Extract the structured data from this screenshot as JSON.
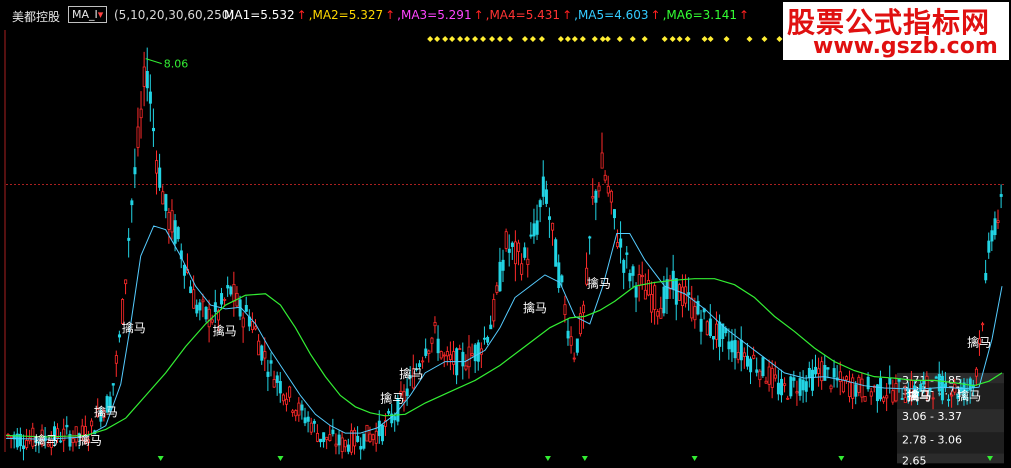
{
  "header": {
    "stock_name": "美都控股",
    "indicator": "MA_I",
    "params": "(5,10,20,30,60,250)",
    "ma_values": [
      {
        "label": "MA1=5.532",
        "color": "#ffffff"
      },
      {
        "label": ",MA2=5.327",
        "color": "#ffd700"
      },
      {
        "label": ",MA3=5.291",
        "color": "#ff44ff"
      },
      {
        "label": ",MA4=5.431",
        "color": "#ff3333"
      },
      {
        "label": ",MA5=4.603",
        "color": "#33ccff"
      },
      {
        "label": ",MA6=3.141",
        "color": "#33ff33"
      }
    ],
    "arrow": "↑"
  },
  "watermark": {
    "title": "股票公式指标网",
    "url": "www.gszb.com"
  },
  "chart_data": {
    "type": "candlestick",
    "ylim": [
      2.8,
      8.4
    ],
    "x_count": 1000,
    "colors": {
      "up": "#ff2a2a",
      "down": "#22d4e4",
      "ma_long": "#33ee33",
      "ma_mid": "#55ccff",
      "ref_line": "#aa2020"
    },
    "ref_level": 6.35,
    "peak_label": {
      "text": "8.06",
      "x": 140,
      "y": 8.06
    },
    "price_path": [
      [
        0,
        3.02
      ],
      [
        20,
        2.97
      ],
      [
        40,
        2.98
      ],
      [
        60,
        3.03
      ],
      [
        70,
        3.0
      ],
      [
        85,
        3.08
      ],
      [
        95,
        3.35
      ],
      [
        105,
        3.5
      ],
      [
        115,
        4.4
      ],
      [
        125,
        6.0
      ],
      [
        135,
        7.2
      ],
      [
        141,
        7.95
      ],
      [
        150,
        6.8
      ],
      [
        160,
        6.0
      ],
      [
        170,
        5.7
      ],
      [
        180,
        5.3
      ],
      [
        190,
        4.75
      ],
      [
        200,
        4.6
      ],
      [
        212,
        4.62
      ],
      [
        225,
        4.95
      ],
      [
        235,
        4.65
      ],
      [
        245,
        4.6
      ],
      [
        255,
        4.2
      ],
      [
        265,
        3.9
      ],
      [
        275,
        3.7
      ],
      [
        285,
        3.5
      ],
      [
        295,
        3.32
      ],
      [
        305,
        3.2
      ],
      [
        315,
        3.0
      ],
      [
        325,
        2.97
      ],
      [
        337,
        2.9
      ],
      [
        350,
        2.96
      ],
      [
        365,
        3.02
      ],
      [
        378,
        3.1
      ],
      [
        392,
        3.35
      ],
      [
        405,
        3.7
      ],
      [
        420,
        4.22
      ],
      [
        430,
        4.35
      ],
      [
        440,
        4.0
      ],
      [
        455,
        4.0
      ],
      [
        468,
        4.1
      ],
      [
        480,
        4.3
      ],
      [
        490,
        4.7
      ],
      [
        500,
        5.55
      ],
      [
        510,
        5.4
      ],
      [
        520,
        5.35
      ],
      [
        530,
        5.7
      ],
      [
        540,
        6.35
      ],
      [
        548,
        5.6
      ],
      [
        555,
        5.1
      ],
      [
        562,
        4.55
      ],
      [
        570,
        4.1
      ],
      [
        580,
        4.75
      ],
      [
        588,
        6.1
      ],
      [
        598,
        6.6
      ],
      [
        608,
        5.95
      ],
      [
        618,
        5.4
      ],
      [
        628,
        5.1
      ],
      [
        640,
        4.95
      ],
      [
        655,
        4.75
      ],
      [
        668,
        5.0
      ],
      [
        680,
        4.85
      ],
      [
        690,
        4.7
      ],
      [
        705,
        4.45
      ],
      [
        720,
        4.3
      ],
      [
        735,
        4.15
      ],
      [
        750,
        4.0
      ],
      [
        765,
        3.8
      ],
      [
        778,
        3.6
      ],
      [
        790,
        3.7
      ],
      [
        805,
        3.75
      ],
      [
        818,
        3.9
      ],
      [
        828,
        3.75
      ],
      [
        840,
        3.7
      ],
      [
        855,
        3.65
      ],
      [
        870,
        3.62
      ],
      [
        880,
        3.62
      ],
      [
        895,
        3.62
      ],
      [
        910,
        3.6
      ],
      [
        930,
        3.68
      ],
      [
        945,
        3.64
      ],
      [
        958,
        3.6
      ],
      [
        970,
        3.7
      ],
      [
        980,
        4.8
      ],
      [
        988,
        5.8
      ],
      [
        998,
        6.0
      ]
    ],
    "ma_mid": [
      [
        0,
        2.98
      ],
      [
        40,
        2.97
      ],
      [
        80,
        3.0
      ],
      [
        100,
        3.15
      ],
      [
        115,
        3.7
      ],
      [
        125,
        4.5
      ],
      [
        135,
        5.4
      ],
      [
        148,
        5.8
      ],
      [
        160,
        5.75
      ],
      [
        175,
        5.4
      ],
      [
        190,
        5.0
      ],
      [
        205,
        4.75
      ],
      [
        220,
        4.7
      ],
      [
        235,
        4.72
      ],
      [
        250,
        4.5
      ],
      [
        265,
        4.15
      ],
      [
        280,
        3.85
      ],
      [
        295,
        3.55
      ],
      [
        310,
        3.3
      ],
      [
        325,
        3.15
      ],
      [
        340,
        3.05
      ],
      [
        355,
        3.05
      ],
      [
        372,
        3.12
      ],
      [
        390,
        3.3
      ],
      [
        405,
        3.55
      ],
      [
        420,
        3.85
      ],
      [
        440,
        4.0
      ],
      [
        460,
        4.0
      ],
      [
        480,
        4.15
      ],
      [
        495,
        4.45
      ],
      [
        510,
        4.85
      ],
      [
        525,
        5.0
      ],
      [
        540,
        5.15
      ],
      [
        555,
        5.05
      ],
      [
        570,
        4.6
      ],
      [
        585,
        4.5
      ],
      [
        598,
        5.0
      ],
      [
        612,
        5.7
      ],
      [
        625,
        5.7
      ],
      [
        640,
        5.35
      ],
      [
        660,
        5.0
      ],
      [
        680,
        4.9
      ],
      [
        700,
        4.7
      ],
      [
        720,
        4.45
      ],
      [
        740,
        4.25
      ],
      [
        760,
        4.05
      ],
      [
        780,
        3.85
      ],
      [
        800,
        3.78
      ],
      [
        820,
        3.8
      ],
      [
        840,
        3.75
      ],
      [
        860,
        3.68
      ],
      [
        880,
        3.65
      ],
      [
        900,
        3.64
      ],
      [
        920,
        3.64
      ],
      [
        940,
        3.66
      ],
      [
        960,
        3.64
      ],
      [
        975,
        3.66
      ],
      [
        988,
        4.3
      ],
      [
        998,
        5.0
      ]
    ],
    "ma_long": [
      [
        0,
        3.02
      ],
      [
        40,
        3.0
      ],
      [
        80,
        3.02
      ],
      [
        100,
        3.1
      ],
      [
        120,
        3.25
      ],
      [
        140,
        3.55
      ],
      [
        160,
        3.85
      ],
      [
        180,
        4.2
      ],
      [
        200,
        4.5
      ],
      [
        220,
        4.75
      ],
      [
        240,
        4.88
      ],
      [
        260,
        4.9
      ],
      [
        275,
        4.75
      ],
      [
        290,
        4.45
      ],
      [
        305,
        4.1
      ],
      [
        320,
        3.8
      ],
      [
        335,
        3.55
      ],
      [
        350,
        3.4
      ],
      [
        365,
        3.32
      ],
      [
        380,
        3.28
      ],
      [
        400,
        3.3
      ],
      [
        420,
        3.45
      ],
      [
        445,
        3.6
      ],
      [
        470,
        3.75
      ],
      [
        495,
        3.95
      ],
      [
        520,
        4.2
      ],
      [
        545,
        4.45
      ],
      [
        565,
        4.58
      ],
      [
        580,
        4.6
      ],
      [
        595,
        4.68
      ],
      [
        610,
        4.8
      ],
      [
        630,
        5.0
      ],
      [
        650,
        5.05
      ],
      [
        670,
        5.08
      ],
      [
        690,
        5.1
      ],
      [
        710,
        5.1
      ],
      [
        730,
        5.02
      ],
      [
        750,
        4.85
      ],
      [
        770,
        4.6
      ],
      [
        790,
        4.4
      ],
      [
        810,
        4.18
      ],
      [
        830,
        4.0
      ],
      [
        850,
        3.88
      ],
      [
        870,
        3.8
      ],
      [
        890,
        3.78
      ],
      [
        910,
        3.75
      ],
      [
        930,
        3.75
      ],
      [
        950,
        3.72
      ],
      [
        970,
        3.68
      ],
      [
        985,
        3.74
      ],
      [
        998,
        3.85
      ]
    ],
    "signals": [
      {
        "label": "擒马",
        "x": 28,
        "y": 2.9,
        "bold": false
      },
      {
        "label": "擒马",
        "x": 72,
        "y": 2.9,
        "bold": false
      },
      {
        "label": "擒马",
        "x": 88,
        "y": 3.28,
        "bold": false
      },
      {
        "label": "擒马",
        "x": 116,
        "y": 4.39,
        "bold": false
      },
      {
        "label": "擒马",
        "x": 207,
        "y": 4.35,
        "bold": false
      },
      {
        "label": "擒马",
        "x": 375,
        "y": 3.46,
        "bold": false
      },
      {
        "label": "擒马",
        "x": 394,
        "y": 3.78,
        "bold": false
      },
      {
        "label": "擒马",
        "x": 518,
        "y": 4.66,
        "bold": false
      },
      {
        "label": "擒马",
        "x": 582,
        "y": 4.98,
        "bold": false
      },
      {
        "label": "擒马",
        "x": 903,
        "y": 3.49,
        "bold": true
      },
      {
        "label": "擒马",
        "x": 953,
        "y": 3.49,
        "bold": false
      },
      {
        "label": "擒马",
        "x": 963,
        "y": 4.2,
        "bold": false
      }
    ],
    "price_zones": [
      {
        "label": "3.71 - 3.85",
        "y_lo": 3.71,
        "y_hi": 3.85
      },
      {
        "label": "3.37 - 3.71",
        "y_lo": 3.37,
        "y_hi": 3.71
      },
      {
        "label": "3.06 - 3.37",
        "y_lo": 3.06,
        "y_hi": 3.37
      },
      {
        "label": "2.78 - 3.06",
        "y_lo": 2.78,
        "y_hi": 3.06
      },
      {
        "label": "2.65",
        "y_lo": 2.65,
        "y_hi": 2.78
      }
    ],
    "marker_x": [
      155,
      275,
      543,
      580,
      690,
      837,
      986
    ],
    "dot_x": [
      425,
      432,
      440,
      447,
      455,
      462,
      470,
      478,
      487,
      495,
      505,
      520,
      528,
      537,
      556,
      563,
      570,
      578,
      590,
      598,
      603,
      615,
      628,
      640,
      660,
      668,
      675,
      683,
      700,
      706,
      722,
      745,
      760,
      775
    ]
  }
}
